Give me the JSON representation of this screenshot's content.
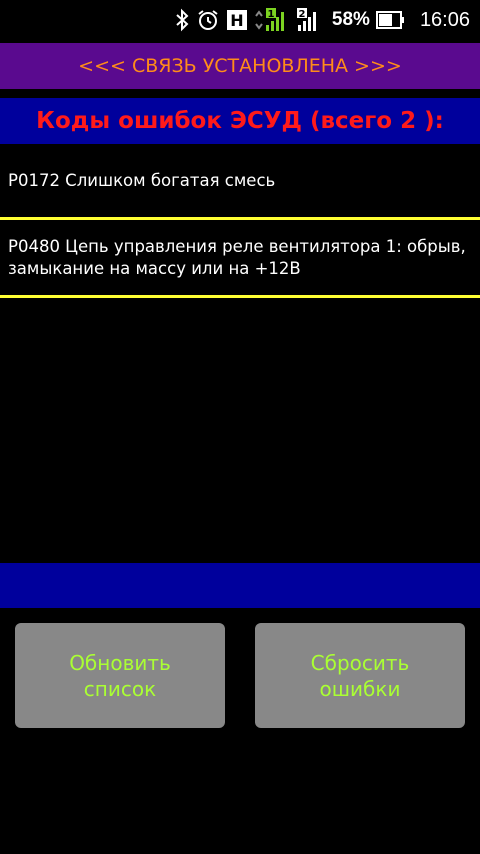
{
  "status_bar": {
    "icons": [
      "bluetooth-icon",
      "alarm-icon",
      "h-network-icon",
      "signal-sim1-icon",
      "signal-sim2-icon",
      "battery-icon"
    ],
    "network_type": "H",
    "sim1_label": "1",
    "sim2_label": "2",
    "battery_percent": "58%",
    "time": "16:06"
  },
  "connection_banner": {
    "text": "<<< СВЯЗЬ УСТАНОВЛЕНА >>>",
    "color": "#ff8c1a",
    "background": "#5a0a8f"
  },
  "codes_header": {
    "text": "Коды ошибок ЭСУД (всего 2 ):",
    "color": "#ff1a1a",
    "background": "#00009c"
  },
  "errors": [
    {
      "text": "P0172 Слишком богатая смесь"
    },
    {
      "text": "P0480 Цепь управления реле вентилятора 1: обрыв, замыкание на массу или на +12В"
    }
  ],
  "buttons": {
    "refresh_label": "Обновить\nсписок",
    "reset_label": "Сбросить\nошибки",
    "label_color": "#aaff33",
    "background": "#888888"
  }
}
